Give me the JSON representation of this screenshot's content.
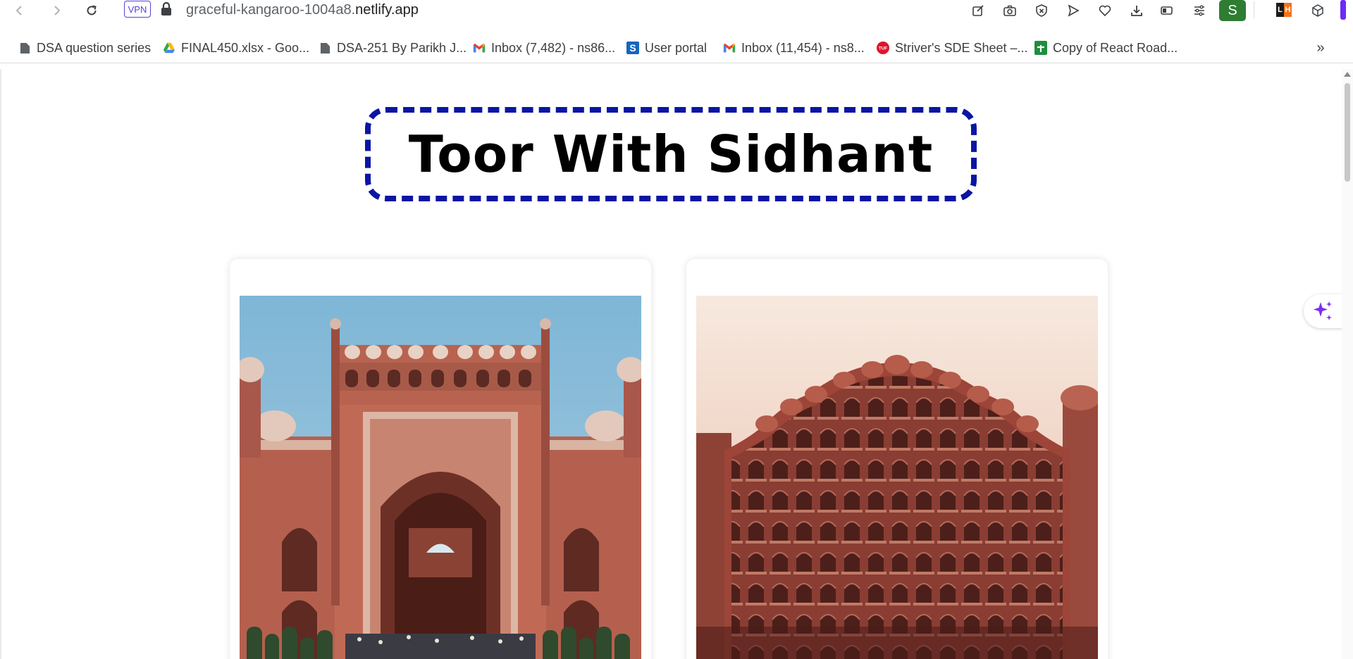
{
  "browser": {
    "vpn_label": "VPN",
    "url_sub": "graceful-kangaroo-1004a8.",
    "url_host": "netlify.app",
    "profile_initial": "S",
    "ext_lh": [
      "L",
      "H"
    ],
    "icons": [
      "back-icon",
      "forward-icon",
      "reload-icon",
      "lock-icon",
      "edit-icon",
      "camera-icon",
      "adblock-icon",
      "send-icon",
      "heart-icon",
      "download-icon",
      "battery-icon",
      "menu-icon",
      "cube-icon"
    ]
  },
  "bookmarks": [
    {
      "label": "DSA question series",
      "icon": "file-icon"
    },
    {
      "label": "FINAL450.xlsx - Goo...",
      "icon": "drive-icon"
    },
    {
      "label": "DSA-251 By Parikh J...",
      "icon": "file-icon"
    },
    {
      "label": "Inbox (7,482) - ns86...",
      "icon": "gmail-icon"
    },
    {
      "label": "User portal",
      "icon": "s-icon"
    },
    {
      "label": "Inbox (11,454) - ns8...",
      "icon": "gmail-icon"
    },
    {
      "label": "Striver's SDE Sheet –...",
      "icon": "tuf-icon"
    },
    {
      "label": "Copy of React Road...",
      "icon": "sheets-icon"
    }
  ],
  "page": {
    "title": "Toor With Sidhant",
    "title_border_color": "#0a15a3",
    "cards": [
      {
        "subject": "Taj Mahal red sandstone gate"
      },
      {
        "subject": "Hawa Mahal palace facade"
      }
    ]
  },
  "colors": {
    "accent": "#6b2cf5",
    "profile_bg": "#2e7d32"
  }
}
